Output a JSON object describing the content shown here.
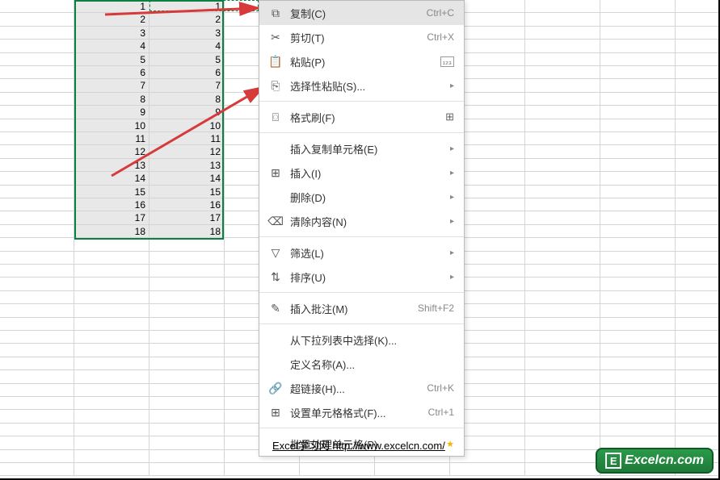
{
  "grid": {
    "colA": [
      1,
      2,
      3,
      4,
      5,
      6,
      7,
      8,
      9,
      10,
      11,
      12,
      13,
      14,
      15,
      16,
      17,
      18
    ],
    "colB": [
      1,
      2,
      3,
      4,
      5,
      6,
      7,
      8,
      9,
      10,
      11,
      12,
      13,
      14,
      15,
      16,
      17,
      18
    ]
  },
  "menu": {
    "copy": "复制(C)",
    "copy_short": "Ctrl+C",
    "cut": "剪切(T)",
    "cut_short": "Ctrl+X",
    "paste": "粘贴(P)",
    "paste_special": "选择性粘贴(S)...",
    "format_painter": "格式刷(F)",
    "insert_copied": "插入复制单元格(E)",
    "insert": "插入(I)",
    "delete": "删除(D)",
    "clear": "清除内容(N)",
    "filter": "筛选(L)",
    "sort": "排序(U)",
    "insert_comment": "插入批注(M)",
    "insert_comment_short": "Shift+F2",
    "dropdown_select": "从下拉列表中选择(K)...",
    "define_name": "定义名称(A)...",
    "hyperlink": "超链接(H)...",
    "hyperlink_short": "Ctrl+K",
    "format_cells": "设置单元格格式(F)...",
    "format_cells_short": "Ctrl+1",
    "batch_cells": "批量处理单元格(P)"
  },
  "footer": {
    "text": "Excel学习网 http://www.excelcn.com/"
  },
  "logo": {
    "letter": "E",
    "text": "Excelcn.com"
  }
}
